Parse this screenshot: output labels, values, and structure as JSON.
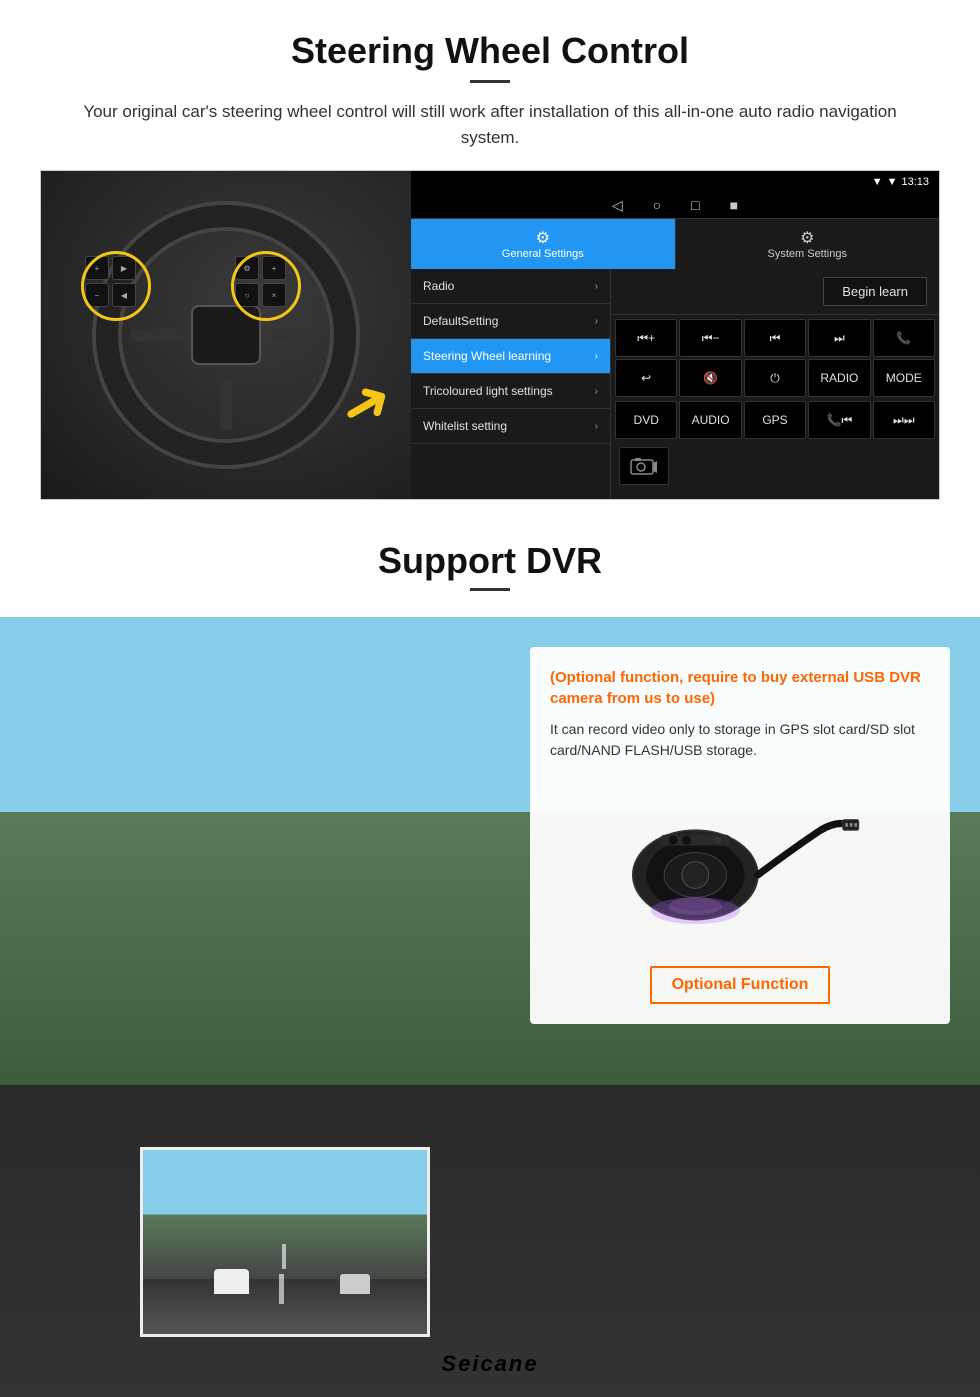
{
  "page": {
    "sections": {
      "steering": {
        "title": "Steering Wheel Control",
        "description": "Your original car's steering wheel control will still work after installation of this all-in-one auto radio navigation system."
      },
      "dvr": {
        "title": "Support DVR"
      }
    }
  },
  "steering_ui": {
    "status_bar": {
      "time": "13:13",
      "signal": "▼",
      "wifi": "▼"
    },
    "tabs": {
      "general": {
        "label": "General Settings",
        "icon": "⚙"
      },
      "system": {
        "label": "System Settings",
        "icon": "🔧"
      }
    },
    "menu_items": [
      {
        "label": "Radio",
        "active": false
      },
      {
        "label": "DefaultSetting",
        "active": false
      },
      {
        "label": "Steering Wheel learning",
        "active": true
      },
      {
        "label": "Tricoloured light settings",
        "active": false
      },
      {
        "label": "Whitelist setting",
        "active": false
      }
    ],
    "begin_learn_btn": "Begin learn",
    "control_buttons": {
      "row1": [
        "⏮+",
        "⏮−",
        "⏮⏮",
        "⏭⏭",
        "📞"
      ],
      "row2": [
        "↩",
        "🔇",
        "⏻",
        "RADIO",
        "MODE"
      ],
      "row3": [
        "DVD",
        "AUDIO",
        "GPS",
        "📞⏮",
        "⏭⏭"
      ]
    }
  },
  "dvr": {
    "optional_text": "(Optional function, require to buy external USB DVR camera from us to use)",
    "description": "It can record video only to storage in GPS slot card/SD slot card/NAND FLASH/USB storage.",
    "optional_function_label": "Optional Function"
  },
  "branding": {
    "name": "Seicane"
  }
}
